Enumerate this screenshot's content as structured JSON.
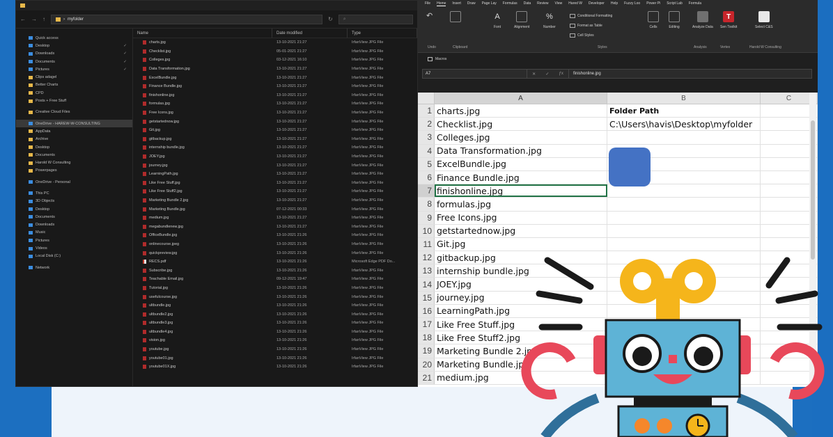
{
  "explorer": {
    "address_path": "myfolder",
    "nav_items": [
      {
        "label": "Quick access",
        "icon": "star-icon"
      },
      {
        "label": "Desktop",
        "icon": "desktop-icon",
        "pinned": true
      },
      {
        "label": "Downloads",
        "icon": "downloads-icon",
        "pinned": true
      },
      {
        "label": "Documents",
        "icon": "documents-icon",
        "pinned": true
      },
      {
        "label": "Pictures",
        "icon": "pictures-icon",
        "pinned": true
      },
      {
        "label": "Clips adagel",
        "icon": "folder-icon"
      },
      {
        "label": "Better Charts",
        "icon": "folder-icon"
      },
      {
        "label": "CPD",
        "icon": "folder-icon"
      },
      {
        "label": "Posts + Free Stuff",
        "icon": "folder-icon"
      },
      {
        "label": "",
        "icon": "gap"
      },
      {
        "label": "Creative Cloud Files",
        "icon": "folder-icon"
      },
      {
        "label": "",
        "icon": "gap"
      },
      {
        "label": "OneDrive - HAREW-W-CONSULTING",
        "icon": "onedrive-icon",
        "selected": true
      },
      {
        "label": "AppData",
        "icon": "folder-icon"
      },
      {
        "label": "Archive",
        "icon": "folder-icon"
      },
      {
        "label": "Desktop",
        "icon": "folder-icon"
      },
      {
        "label": "Documents",
        "icon": "folder-icon"
      },
      {
        "label": "Harold W Consulting",
        "icon": "folder-icon"
      },
      {
        "label": "Powerpages",
        "icon": "folder-icon"
      },
      {
        "label": "",
        "icon": "gap"
      },
      {
        "label": "OneDrive - Personal",
        "icon": "onedrive-icon"
      },
      {
        "label": "",
        "icon": "gap"
      },
      {
        "label": "This PC",
        "icon": "pc-icon"
      },
      {
        "label": "3D Objects",
        "icon": "cube-icon"
      },
      {
        "label": "Desktop",
        "icon": "desktop-icon"
      },
      {
        "label": "Documents",
        "icon": "documents-icon"
      },
      {
        "label": "Downloads",
        "icon": "downloads-icon"
      },
      {
        "label": "Music",
        "icon": "music-icon"
      },
      {
        "label": "Pictures",
        "icon": "pictures-icon"
      },
      {
        "label": "Videos",
        "icon": "videos-icon"
      },
      {
        "label": "Local Disk (C:)",
        "icon": "disk-icon"
      },
      {
        "label": "",
        "icon": "gap"
      },
      {
        "label": "Network",
        "icon": "network-icon"
      }
    ],
    "columns": {
      "name": "Name",
      "date": "Date modified",
      "type": "Type"
    },
    "files": [
      {
        "name": "charts.jpg",
        "date": "13-10-2021 21:27",
        "type": "IrfanView JPG File"
      },
      {
        "name": "Checklist.jpg",
        "date": "05-01-2021 21:27",
        "type": "IrfanView JPG File"
      },
      {
        "name": "Colleges.jpg",
        "date": "03-12-2021 16:10",
        "type": "IrfanView JPG File"
      },
      {
        "name": "Data Transformation.jpg",
        "date": "13-10-2021 21:27",
        "type": "IrfanView JPG File"
      },
      {
        "name": "ExcelBundle.jpg",
        "date": "13-10-2021 21:27",
        "type": "IrfanView JPG File"
      },
      {
        "name": "Finance Bundle.jpg",
        "date": "13-10-2021 21:27",
        "type": "IrfanView JPG File"
      },
      {
        "name": "finishonline.jpg",
        "date": "13-10-2021 21:27",
        "type": "IrfanView JPG File"
      },
      {
        "name": "formulas.jpg",
        "date": "13-10-2021 21:27",
        "type": "IrfanView JPG File"
      },
      {
        "name": "Free Icons.jpg",
        "date": "13-10-2021 21:27",
        "type": "IrfanView JPG File"
      },
      {
        "name": "getstartednow.jpg",
        "date": "13-10-2021 21:27",
        "type": "IrfanView JPG File"
      },
      {
        "name": "Git.jpg",
        "date": "13-10-2021 21:27",
        "type": "IrfanView JPG File"
      },
      {
        "name": "gitbackup.jpg",
        "date": "13-10-2021 21:27",
        "type": "IrfanView JPG File"
      },
      {
        "name": "internship bundle.jpg",
        "date": "13-10-2021 21:27",
        "type": "IrfanView JPG File"
      },
      {
        "name": "JOEY.jpg",
        "date": "13-10-2021 21:27",
        "type": "IrfanView JPG File"
      },
      {
        "name": "journey.jpg",
        "date": "13-10-2021 21:27",
        "type": "IrfanView JPG File"
      },
      {
        "name": "LearningPath.jpg",
        "date": "13-10-2021 21:27",
        "type": "IrfanView JPG File"
      },
      {
        "name": "Like Free Stuff.jpg",
        "date": "13-10-2021 21:27",
        "type": "IrfanView JPG File"
      },
      {
        "name": "Like Free Stuff2.jpg",
        "date": "13-10-2021 21:27",
        "type": "IrfanView JPG File"
      },
      {
        "name": "Marketing Bundle 2.jpg",
        "date": "13-10-2021 21:27",
        "type": "IrfanView JPG File"
      },
      {
        "name": "Marketing Bundle.jpg",
        "date": "07-12-2021 00:33",
        "type": "IrfanView JPG File"
      },
      {
        "name": "medium.jpg",
        "date": "13-10-2021 21:27",
        "type": "IrfanView JPG File"
      },
      {
        "name": "megabundlenew.jpg",
        "date": "13-10-2021 21:27",
        "type": "IrfanView JPG File"
      },
      {
        "name": "OfficeBundle.jpg",
        "date": "13-10-2021 21:26",
        "type": "IrfanView JPG File"
      },
      {
        "name": "onlinecourse.jpeg",
        "date": "13-10-2021 21:26",
        "type": "IrfanView JPG File"
      },
      {
        "name": "quickpreview.jpg",
        "date": "13-10-2021 21:26",
        "type": "IrfanView JPG File"
      },
      {
        "name": "RECS.pdf",
        "date": "13-10-2021 21:26",
        "type": "Microsoft Edge PDF Do...",
        "pdf": true
      },
      {
        "name": "Subscribe.jpg",
        "date": "13-10-2021 21:26",
        "type": "IrfanView JPG File"
      },
      {
        "name": "Teachable Email.jpg",
        "date": "09-12-2021 19:47",
        "type": "IrfanView JPG File"
      },
      {
        "name": "Tutorial.jpg",
        "date": "13-10-2021 21:26",
        "type": "IrfanView JPG File"
      },
      {
        "name": "usefulcourse.jpg",
        "date": "13-10-2021 21:26",
        "type": "IrfanView JPG File"
      },
      {
        "name": "ultbundle.jpg",
        "date": "13-10-2021 21:26",
        "type": "IrfanView JPG File"
      },
      {
        "name": "ultbundle2.jpg",
        "date": "13-10-2021 21:26",
        "type": "IrfanView JPG File"
      },
      {
        "name": "ultbundle3.jpg",
        "date": "13-10-2021 21:26",
        "type": "IrfanView JPG File"
      },
      {
        "name": "ultbundle4.jpg",
        "date": "13-10-2021 21:26",
        "type": "IrfanView JPG File"
      },
      {
        "name": "vision.jpg",
        "date": "13-10-2021 21:26",
        "type": "IrfanView JPG File"
      },
      {
        "name": "youtube.jpg",
        "date": "13-10-2021 21:26",
        "type": "IrfanView JPG File"
      },
      {
        "name": "youtube01.jpg",
        "date": "13-10-2021 21:26",
        "type": "IrfanView JPG File"
      },
      {
        "name": "youtube01X.jpg",
        "date": "13-10-2021 21:26",
        "type": "IrfanView JPG File"
      }
    ]
  },
  "excel": {
    "menu": [
      "File",
      "Home",
      "Insert",
      "Draw",
      "Page Lay",
      "Formulas",
      "Data",
      "Review",
      "View",
      "Hared W",
      "Developer",
      "Help",
      "Fuzzy Loo",
      "Power Pi",
      "Script Lab",
      "Formula"
    ],
    "active_menu_index": 1,
    "ribbon": {
      "undo_label": "Undo",
      "clipboard_label": "Clipboard",
      "font_label": "Font",
      "alignment_label": "Alignment",
      "number_label": "Number",
      "cond_format": "Conditional Formatting",
      "format_table": "Format as Table",
      "cell_styles": "Cell Styles",
      "styles_label": "Styles",
      "cells_label": "Cells",
      "editing_label": "Editing",
      "analyze_label": "Analyze Data",
      "analysis_label": "Analysis",
      "sen_label": "Sen Toolkit",
      "vertex_label": "Vertex",
      "sheet_label": "Select C&S",
      "harold_label": "Harold W Consulting"
    },
    "macros_label": "Macros",
    "name_box": "A7",
    "formula_value": "finishonline.jpg",
    "columns": [
      "A",
      "B",
      "C"
    ],
    "rows": [
      {
        "num": "1",
        "a": "charts.jpg",
        "b": "Folder Path",
        "b_bold": true
      },
      {
        "num": "2",
        "a": "Checklist.jpg",
        "b": "C:\\Users\\havis\\Desktop\\myfolder"
      },
      {
        "num": "3",
        "a": "Colleges.jpg",
        "b": ""
      },
      {
        "num": "4",
        "a": "Data Transformation.jpg",
        "b": ""
      },
      {
        "num": "5",
        "a": "ExcelBundle.jpg",
        "b": ""
      },
      {
        "num": "6",
        "a": "Finance Bundle.jpg",
        "b": ""
      },
      {
        "num": "7",
        "a": "finishonline.jpg",
        "b": "",
        "selected": true
      },
      {
        "num": "8",
        "a": "formulas.jpg",
        "b": ""
      },
      {
        "num": "9",
        "a": "Free Icons.jpg",
        "b": ""
      },
      {
        "num": "10",
        "a": "getstartednow.jpg",
        "b": ""
      },
      {
        "num": "11",
        "a": "Git.jpg",
        "b": ""
      },
      {
        "num": "12",
        "a": "gitbackup.jpg",
        "b": ""
      },
      {
        "num": "13",
        "a": "internship bundle.jpg",
        "b": ""
      },
      {
        "num": "14",
        "a": "JOEY.jpg",
        "b": ""
      },
      {
        "num": "15",
        "a": "journey.jpg",
        "b": ""
      },
      {
        "num": "16",
        "a": "LearningPath.jpg",
        "b": ""
      },
      {
        "num": "17",
        "a": "Like Free Stuff.jpg",
        "b": ""
      },
      {
        "num": "18",
        "a": "Like Free Stuff2.jpg",
        "b": ""
      },
      {
        "num": "19",
        "a": "Marketing Bundle 2.jpg",
        "b": ""
      },
      {
        "num": "20",
        "a": "Marketing Bundle.jpg",
        "b": ""
      },
      {
        "num": "21",
        "a": "medium.jpg",
        "b": ""
      }
    ]
  },
  "colors": {
    "background_blue": "#1c6fc0",
    "excel_green": "#217346",
    "shape_blue": "#4472c4",
    "robot_body": "#5eb3d6",
    "robot_yellow": "#f5b51b",
    "robot_red": "#e8485a"
  }
}
